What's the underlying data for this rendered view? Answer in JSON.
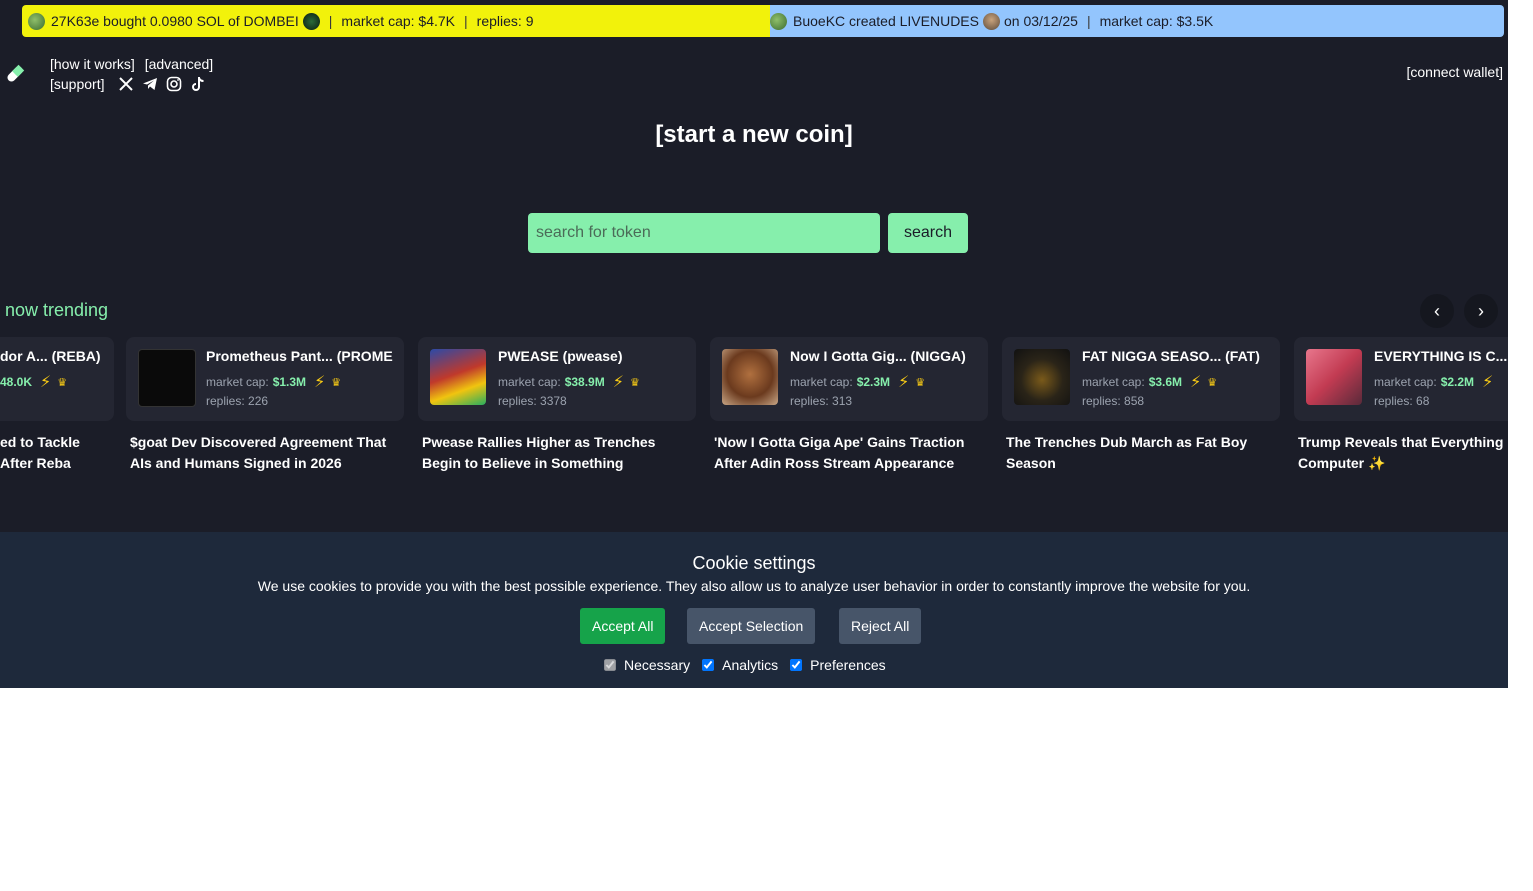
{
  "ticker": [
    {
      "text": "27K63e bought 0.0980 SOL of DOMBEI",
      "market_cap": "market cap: $4.7K",
      "replies": "replies: 9"
    },
    {
      "text_a": "BuoeKC created LIVENUDES",
      "text_b": "on 03/12/25",
      "market_cap": "market cap: $3.5K"
    }
  ],
  "nav": {
    "how_it_works": "[how it works]",
    "advanced": "[advanced]",
    "support": "[support]",
    "connect_wallet": "[connect wallet]"
  },
  "start_coin": "[start a new coin]",
  "search": {
    "placeholder": "search for token",
    "button": "search"
  },
  "trending": {
    "label": "now trending",
    "cards": [
      {
        "name": "dor A... (REBA)",
        "mcap_label": "",
        "mcap": "48.0K",
        "replies": "",
        "headline1": "ed to Tackle",
        "headline2": "After Reba"
      },
      {
        "name": "Prometheus Pant... (PROME",
        "mcap_label": "market cap:",
        "mcap": "$1.3M",
        "replies": "replies: 226",
        "headline1": "$goat Dev Discovered Agreement That",
        "headline2": "AIs and Humans Signed in 2026"
      },
      {
        "name": "PWEASE (pwease)",
        "mcap_label": "market cap:",
        "mcap": "$38.9M",
        "replies": "replies: 3378",
        "headline1": "Pwease Rallies Higher as Trenches",
        "headline2": "Begin to Believe in Something"
      },
      {
        "name": "Now I Gotta Gig... (NIGGA)",
        "mcap_label": "market cap:",
        "mcap": "$2.3M",
        "replies": "replies: 313",
        "headline1": "'Now I Gotta Giga Ape' Gains Traction",
        "headline2": "After Adin Ross Stream Appearance"
      },
      {
        "name": "FAT NIGGA SEASO... (FAT)",
        "mcap_label": "market cap:",
        "mcap": "$3.6M",
        "replies": "replies: 858",
        "headline1": "The Trenches Dub March as Fat Boy",
        "headline2": "Season"
      },
      {
        "name": "EVERYTHING IS C...",
        "mcap_label": "market cap:",
        "mcap": "$2.2M",
        "replies": "replies: 68",
        "headline1": "Trump Reveals that Everything",
        "headline2": "Computer ✨"
      }
    ]
  },
  "cookie": {
    "title": "Cookie settings",
    "description": "We use cookies to provide you with the best possible experience. They also allow us to analyze user behavior in order to constantly improve the website for you.",
    "accept_all": "Accept All",
    "accept_selection": "Accept Selection",
    "reject_all": "Reject All",
    "options": [
      "Necessary",
      "Analytics",
      "Preferences"
    ]
  },
  "colors": {
    "accent_green": "#86efac",
    "ticker_yellow": "#f2f20b",
    "ticker_blue": "#93c5fd",
    "page_bg": "#1b1d28",
    "cookie_bg": "#1e293b",
    "accept_green": "#16a34a"
  }
}
